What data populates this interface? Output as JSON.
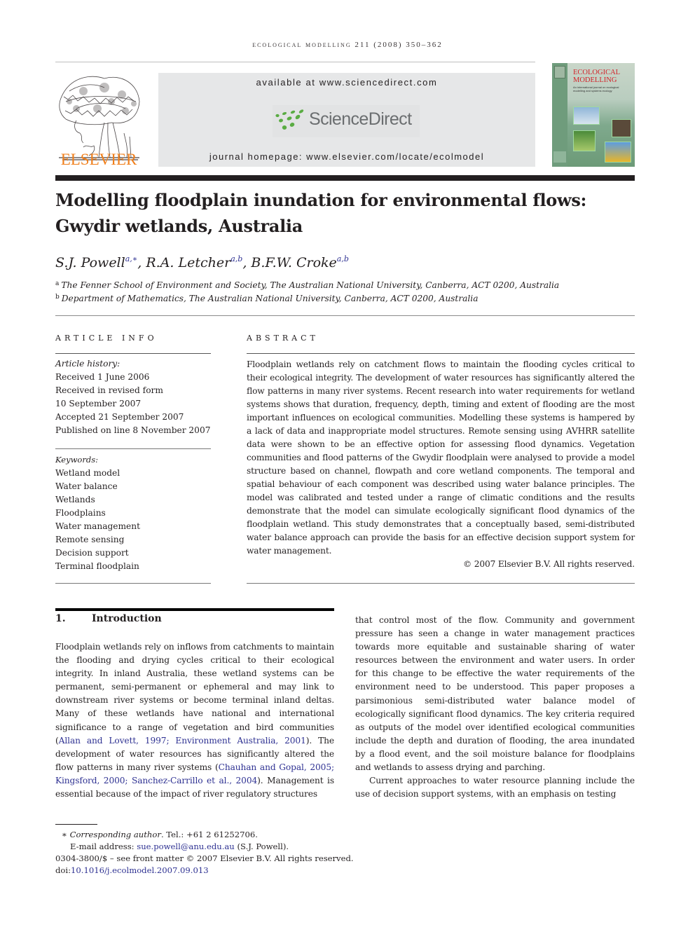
{
  "running_head": "Ecological Modelling 211 (2008) 350–362",
  "publisher": {
    "name": "ELSEVIER",
    "logo_icon": "elsevier-tree-icon",
    "brand_color": "#f07f1b"
  },
  "banner": {
    "available_at": "available at www.sciencedirect.com",
    "sd_logo_text": "ScienceDirect",
    "sd_logo_icon": "sciencedirect-dots-icon",
    "sd_green": "#5aac43",
    "journal_homepage": "journal homepage: www.elsevier.com/locate/ecolmodel"
  },
  "cover": {
    "title_line1": "ECOLOGICAL",
    "title_line2": "MODELLING",
    "subtitle": "An international journal on ecological modelling and systems ecology",
    "title_color": "#d2232a"
  },
  "article": {
    "title_line1": "Modelling floodplain inundation for environmental flows:",
    "title_line2": "Gwydir wetlands, Australia",
    "authors": [
      {
        "name": "S.J. Powell",
        "sup": "a,∗"
      },
      {
        "name": "R.A. Letcher",
        "sup": "a,b"
      },
      {
        "name": "B.F.W. Croke",
        "sup": "a,b"
      }
    ],
    "affiliations": [
      {
        "mark": "a",
        "text": "The Fenner School of Environment and Society, The Australian National University, Canberra, ACT 0200, Australia"
      },
      {
        "mark": "b",
        "text": "Department of Mathematics, The Australian National University, Canberra, ACT 0200, Australia"
      }
    ]
  },
  "article_info": {
    "heading": "article info",
    "history_label": "Article history:",
    "history": [
      "Received 1 June 2006",
      "Received in revised form",
      "10 September 2007",
      "Accepted 21 September 2007",
      "Published on line 8 November 2007"
    ],
    "keywords_label": "Keywords:",
    "keywords": [
      "Wetland model",
      "Water balance",
      "Wetlands",
      "Floodplains",
      "Water management",
      "Remote sensing",
      "Decision support",
      "Terminal floodplain"
    ]
  },
  "abstract": {
    "heading": "abstract",
    "text": "Floodplain wetlands rely on catchment flows to maintain the flooding cycles critical to their ecological integrity. The development of water resources has significantly altered the flow patterns in many river systems. Recent research into water requirements for wetland systems shows that duration, frequency, depth, timing and extent of flooding are the most important influences on ecological communities. Modelling these systems is hampered by a lack of data and inappropriate model structures. Remote sensing using AVHRR satellite data were shown to be an effective option for assessing flood dynamics. Vegetation communities and flood patterns of the Gwydir floodplain were analysed to provide a model structure based on channel, flowpath and core wetland components. The temporal and spatial behaviour of each component was described using water balance principles. The model was calibrated and tested under a range of climatic conditions and the results demonstrate that the model can simulate ecologically significant flood dynamics of the floodplain wetland. This study demonstrates that a conceptually based, semi-distributed water balance approach can provide the basis for an effective decision support system for water management.",
    "copyright": "© 2007 Elsevier B.V. All rights reserved."
  },
  "introduction": {
    "number": "1.",
    "heading": "Introduction",
    "left_col": {
      "p1_a": "Floodplain wetlands rely on inflows from catchments to maintain the flooding and drying cycles critical to their ecological integrity. In inland Australia, these wetland systems can be permanent, semi-permanent or ephemeral and may link to downstream river systems or become terminal inland deltas. Many of these wetlands have national and international significance to a range of vegetation and bird communities (",
      "cite1": "Allan and Lovett, 1997; Environment Australia, 2001",
      "p1_b": "). The development of water resources has significantly altered the flow patterns in many river systems (",
      "cite2": "Chauhan and Gopal, 2005; Kingsford, 2000; Sanchez-Carrillo et al., 2004",
      "p1_c": "). Management is essential because of the impact of river regulatory structures"
    },
    "right_col": {
      "p1": "that control most of the flow. Community and government pressure has seen a change in water management practices towards more equitable and sustainable sharing of water resources between the environment and water users. In order for this change to be effective the water requirements of the environment need to be understood. This paper proposes a parsimonious semi-distributed water balance model of ecologically significant flood dynamics. The key criteria required as outputs of the model over identified ecological communities include the depth and duration of flooding, the area inundated by a flood event, and the soil moisture balance for floodplains and wetlands to assess drying and parching.",
      "p2": "Current approaches to water resource planning include the use of decision support systems, with an emphasis on testing"
    }
  },
  "footnotes": {
    "star": "∗",
    "corresponding_label": "Corresponding author",
    "tel": ". Tel.: +61 2 61252706.",
    "email_label": "E-mail address: ",
    "email": "sue.powell@anu.edu.au",
    "email_owner": " (S.J. Powell).",
    "issn_line": "0304-3800/$ – see front matter © 2007 Elsevier B.V. All rights reserved.",
    "doi_label": "doi:",
    "doi": "10.1016/j.ecolmodel.2007.09.013"
  }
}
